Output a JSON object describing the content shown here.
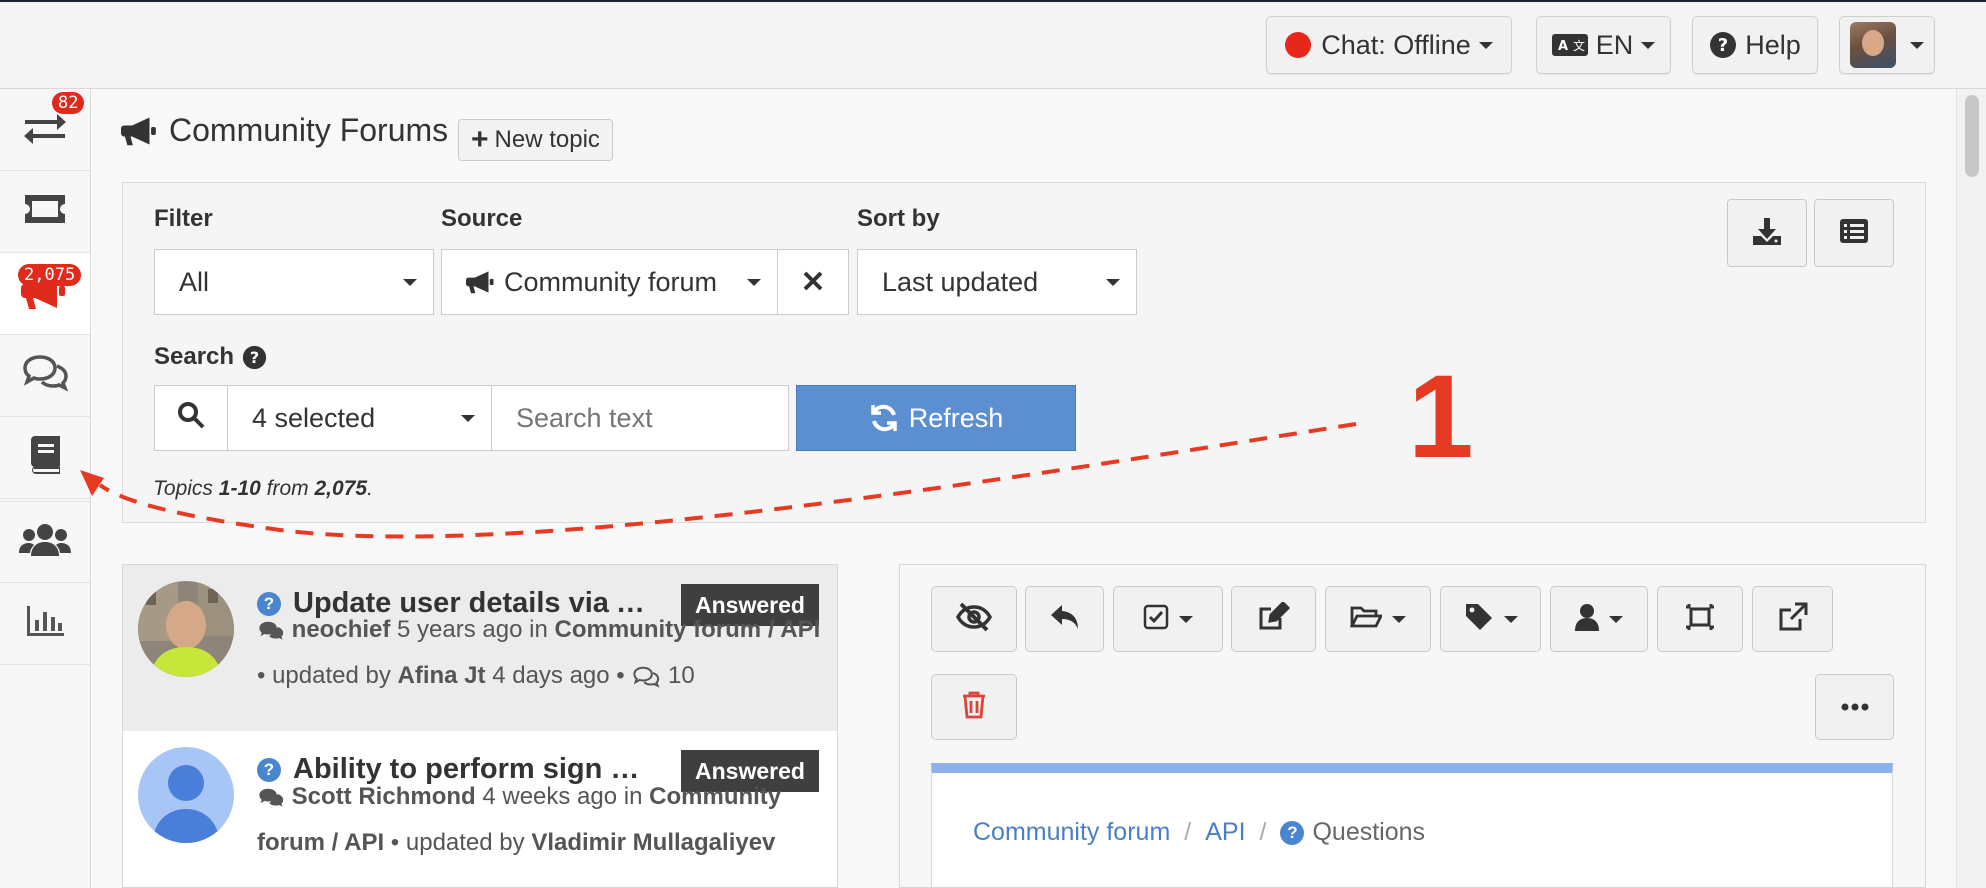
{
  "topbar": {
    "chat_label": "Chat: Offline",
    "chat_status_color": "#e8271b",
    "language_label": "EN",
    "help_label": "Help"
  },
  "sidebar": {
    "items": [
      {
        "icon": "swap-arrows-icon"
      },
      {
        "icon": "ticket-icon",
        "badge": "82"
      },
      {
        "icon": "megaphone-icon",
        "badge": "2,075",
        "active": true
      },
      {
        "icon": "chat-bubbles-icon"
      },
      {
        "icon": "book-icon"
      },
      {
        "icon": "users-icon"
      },
      {
        "icon": "bar-chart-icon"
      }
    ]
  },
  "page": {
    "title": "Community Forums",
    "new_topic_label": "New topic"
  },
  "filters": {
    "filter_label": "Filter",
    "filter_value": "All",
    "source_label": "Source",
    "source_value": "Community forum",
    "sort_label": "Sort by",
    "sort_value": "Last updated",
    "search_label": "Search",
    "search_fields_value": "4 selected",
    "search_placeholder": "Search text",
    "refresh_label": "Refresh",
    "count_prefix": "Topics",
    "count_range": "1-10",
    "count_from": "from",
    "count_total": "2,075",
    "count_suffix": "."
  },
  "annotation": {
    "number": "1",
    "color": "#e63b22"
  },
  "topics": [
    {
      "title": "Update user details via API",
      "status": "Answered",
      "author": "neochief",
      "time": "5 years ago",
      "in_word": "in",
      "category": "Community forum / API",
      "updated_text": "• updated by",
      "updater": "Afina Jt",
      "updated_time": "4 days ago •",
      "replies": "10"
    },
    {
      "title": "Ability to perform sign up via API",
      "status": "Answered",
      "author": "Scott Richmond",
      "time": "4 weeks ago",
      "in_word": "in",
      "category": "Community forum / API",
      "updated_text": "• updated by",
      "updater": "Vladimir Mullagaliyev"
    }
  ],
  "breadcrumb": {
    "forum": "Community forum",
    "section": "API",
    "current": "Questions"
  }
}
